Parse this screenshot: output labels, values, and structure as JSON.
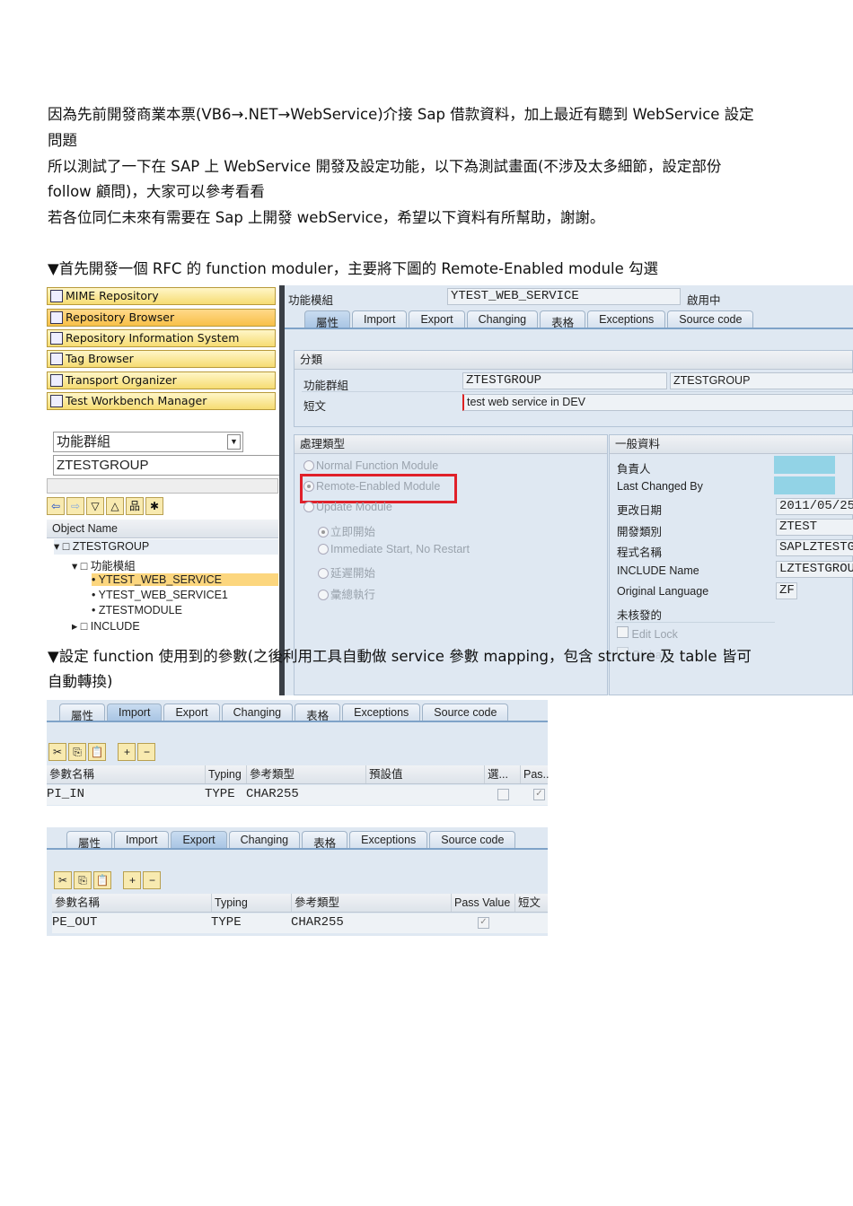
{
  "intro": {
    "line1": "因為先前開發商業本票(VB6→.NET→WebService)介接 Sap 借款資料，加上最近有聽到 WebService 設定",
    "line2": "問題",
    "line3": "所以測試了一下在 SAP 上 WebService 開發及設定功能，以下為測試畫面(不涉及太多細節，設定部份",
    "line4": "follow 顧問)，大家可以參考看看",
    "line5": "若各位同仁未來有需要在 Sap 上開發 webService，希望以下資料有所幫助，謝謝。",
    "step1": "▼首先開發一個 RFC 的 function moduler，主要將下圖的 Remote-Enabled module 勾選",
    "step2a": "▼設定 function 使用到的參數(之後利用工具自動做 service 參數 mapping，包含 strcture 及 table 皆可",
    "step2b": "自動轉換)"
  },
  "nav": {
    "buttons": [
      "MIME Repository",
      "Repository Browser",
      "Repository Information System",
      "Tag Browser",
      "Transport Organizer",
      "Test Workbench Manager"
    ],
    "object_type": "功能群組",
    "object_value": "ZTESTGROUP",
    "tree_header": "Object Name",
    "tree": [
      "ZTESTGROUP",
      "功能模組",
      "YTEST_WEB_SERVICE",
      "YTEST_WEB_SERVICE1",
      "ZTESTMODULE",
      "INCLUDE"
    ]
  },
  "fm": {
    "label": "功能模組",
    "name": "YTEST_WEB_SERVICE",
    "status": "啟用中",
    "tabs": [
      "屬性",
      "Import",
      "Export",
      "Changing",
      "表格",
      "Exceptions",
      "Source code"
    ],
    "class_title": "分類",
    "group_label": "功能群組",
    "group_value": "ZTESTGROUP",
    "group_text": "ZTESTGROUP",
    "short_label": "短文",
    "short_value": "test web service in DEV",
    "proc_title": "處理類型",
    "proc": [
      "Normal Function Module",
      "Remote-Enabled Module",
      "Update Module",
      "立即開始",
      "Immediate Start, No Restart",
      "延遲開始",
      "彙總執行"
    ],
    "gen_title": "一般資料",
    "gen": [
      {
        "label": "負責人",
        "value": ""
      },
      {
        "label": "Last Changed By",
        "value": ""
      },
      {
        "label": "更改日期",
        "value": "2011/05/25"
      },
      {
        "label": "開發類別",
        "value": "ZTEST"
      },
      {
        "label": "程式名稱",
        "value": "SAPLZTESTG"
      },
      {
        "label": "INCLUDE Name",
        "value": "LZTESTGROU"
      },
      {
        "label": "Original Language",
        "value": "ZF"
      },
      {
        "label": "未核發的",
        "value": ""
      }
    ],
    "edit_lock": "Edit Lock",
    "global": "Global"
  },
  "import": {
    "tabs": [
      "屬性",
      "Import",
      "Export",
      "Changing",
      "表格",
      "Exceptions",
      "Source code"
    ],
    "cols": [
      "參數名稱",
      "Typing",
      "參考類型",
      "預設值",
      "選...",
      "Pas.."
    ],
    "row": [
      "PI_IN",
      "TYPE",
      "CHAR255"
    ]
  },
  "export": {
    "tabs": [
      "屬性",
      "Import",
      "Export",
      "Changing",
      "表格",
      "Exceptions",
      "Source code"
    ],
    "cols": [
      "參數名稱",
      "Typing",
      "參考類型",
      "Pass Value",
      "短文"
    ],
    "row": [
      "PE_OUT",
      "TYPE",
      "CHAR255"
    ]
  }
}
